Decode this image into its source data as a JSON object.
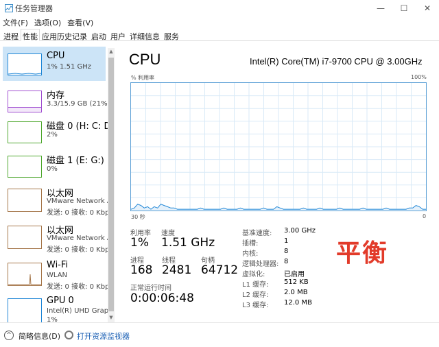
{
  "window": {
    "title": "任务管理器",
    "controls": {
      "minimize": "—",
      "maximize": "☐",
      "close": "✕"
    }
  },
  "menu": [
    "文件(F)",
    "选项(O)",
    "查看(V)"
  ],
  "tabs": [
    {
      "label": "进程",
      "active": false
    },
    {
      "label": "性能",
      "active": true
    },
    {
      "label": "应用历史记录",
      "active": false
    },
    {
      "label": "启动",
      "active": false
    },
    {
      "label": "用户",
      "active": false
    },
    {
      "label": "详细信息",
      "active": false
    },
    {
      "label": "服务",
      "active": false
    }
  ],
  "sidebar": [
    {
      "name": "CPU",
      "sub1": "1% 1.51 GHz",
      "sub2": "",
      "color": "#1f86d6",
      "selected": true
    },
    {
      "name": "内存",
      "sub1": "3.3/15.9 GB (21%)",
      "sub2": "",
      "color": "#a04dd0",
      "selected": false
    },
    {
      "name": "磁盘 0 (H: C: D",
      "sub1": "2%",
      "sub2": "",
      "color": "#4ea72e",
      "selected": false
    },
    {
      "name": "磁盘 1 (E: G:)",
      "sub1": "0%",
      "sub2": "",
      "color": "#4ea72e",
      "selected": false
    },
    {
      "name": "以太网",
      "sub1": "VMware Network A",
      "sub2": "发送: 0 接收: 0 Kbp",
      "color": "#a5764a",
      "selected": false
    },
    {
      "name": "以太网",
      "sub1": "VMware Network A",
      "sub2": "发送: 0 接收: 0 Kbp",
      "color": "#a5764a",
      "selected": false
    },
    {
      "name": "Wi-Fi",
      "sub1": "WLAN",
      "sub2": "发送: 0 接收: 0 Kbp",
      "color": "#a5764a",
      "selected": false
    },
    {
      "name": "GPU 0",
      "sub1": "Intel(R) UHD Graph",
      "sub2": "1%",
      "color": "#1f86d6",
      "selected": false
    }
  ],
  "main": {
    "title": "CPU",
    "model": "Intel(R) Core(TM) i7-9700 CPU @ 3.00GHz",
    "graph": {
      "y_label": "% 利用率",
      "y_max_label": "100%",
      "x_left_label": "30 秒",
      "x_right_label": "0",
      "line_color": "#1f86d6",
      "grid_color": "#d9eaf7",
      "utilization_series": [
        1,
        2,
        5,
        4,
        2,
        3,
        1,
        3,
        2,
        5,
        4,
        3,
        2,
        2,
        1,
        1,
        1,
        1,
        1,
        1,
        1,
        2,
        1,
        1,
        1,
        1,
        1,
        1,
        2,
        1,
        1,
        1,
        1,
        2,
        1,
        1,
        1,
        1,
        1,
        1,
        2,
        1,
        1,
        1,
        3,
        2,
        1,
        1,
        1,
        1,
        1,
        1,
        2,
        1,
        1,
        1,
        1,
        2,
        1,
        1,
        1,
        1,
        1,
        2,
        1,
        1,
        1,
        1,
        1,
        1,
        2,
        1,
        1,
        1,
        1,
        1,
        1,
        2,
        1,
        1,
        1,
        1,
        1,
        1,
        2,
        2,
        4,
        3,
        1,
        1
      ]
    },
    "stats": {
      "utilization": {
        "label": "利用率",
        "value": "1%"
      },
      "speed": {
        "label": "速度",
        "value": "1.51 GHz"
      },
      "processes": {
        "label": "进程",
        "value": "168"
      },
      "threads": {
        "label": "线程",
        "value": "2481"
      },
      "handles": {
        "label": "句柄",
        "value": "64712"
      },
      "uptime": {
        "label": "正常运行时间",
        "value": "0:00:06:48"
      }
    },
    "info": [
      {
        "label": "基准速度:",
        "value": "3.00 GHz"
      },
      {
        "label": "插槽:",
        "value": "1"
      },
      {
        "label": "内核:",
        "value": "8"
      },
      {
        "label": "逻辑处理器:",
        "value": "8"
      },
      {
        "label": "虚拟化:",
        "value": "已启用"
      },
      {
        "label": "L1 缓存:",
        "value": "512 KB"
      },
      {
        "label": "L2 缓存:",
        "value": "2.0 MB"
      },
      {
        "label": "L3 缓存:",
        "value": "12.0 MB"
      }
    ],
    "overlay_text": "平衡"
  },
  "footer": {
    "less_details": "简略信息(D)",
    "open_monitor": "打开资源监视器"
  }
}
